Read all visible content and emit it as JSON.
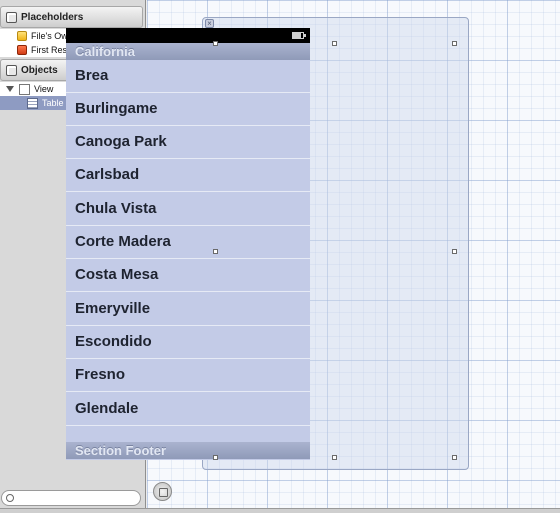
{
  "sidebar": {
    "placeholders_header": "Placeholders",
    "placeholders": [
      {
        "label": "File's Owner",
        "icon": "files-owner-icon"
      },
      {
        "label": "First Responder",
        "icon": "first-responder-icon"
      }
    ],
    "objects_header": "Objects",
    "objects": [
      {
        "label": "View",
        "icon": "view-icon",
        "expanded": true
      },
      {
        "label": "Table View",
        "icon": "table-view-icon",
        "selected": true
      }
    ],
    "search": {
      "placeholder": ""
    }
  },
  "table": {
    "section_header": "California",
    "rows": [
      "Brea",
      "Burlingame",
      "Canoga Park",
      "Carlsbad",
      "Chula Vista",
      "Corte Madera",
      "Costa Mesa",
      "Emeryville",
      "Escondido",
      "Fresno",
      "Glendale"
    ],
    "section_footer": "Section Footer"
  },
  "colors": {
    "table_background": "#c3cbe7",
    "section_bar": "#8f9ab8",
    "selection": "#8e9bc2",
    "status_bar": "#000000"
  }
}
